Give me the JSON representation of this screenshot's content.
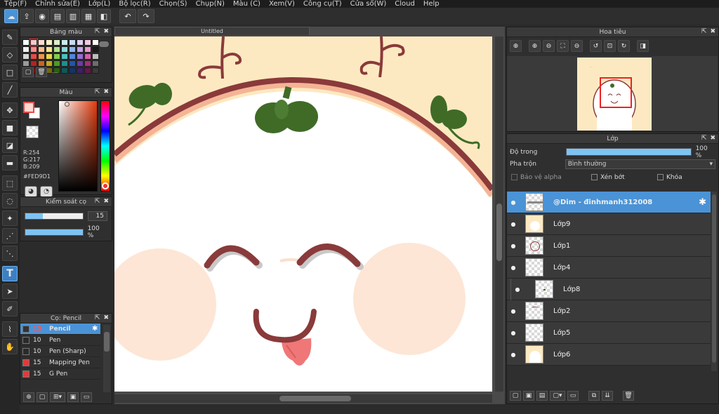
{
  "menu": [
    "Tệp(F)",
    "Chỉnh sửa(E)",
    "Lớp(L)",
    "Bộ lọc(R)",
    "Chọn(S)",
    "Chụp(N)",
    "Màu (C)",
    "Xem(V)",
    "Công cụ(T)",
    "Cửa sổ(W)",
    "Cloud",
    "Help"
  ],
  "canvas": {
    "tab_title": "Untitled"
  },
  "palette_panel": {
    "title": "Bảng màu",
    "footer_text": "---",
    "swatches": [
      "#ffffff",
      "#f9c9c9",
      "#fbe0c8",
      "#f8f1c6",
      "#d9f0c6",
      "#c9ecec",
      "#c8daf5",
      "#e1d2f2",
      "#f2c9e3",
      "#ffffff",
      "#f1f1f1",
      "#f48e8e",
      "#f7bd8c",
      "#f4e58d",
      "#b2e28d",
      "#8dd8d8",
      "#8fb5ec",
      "#c3a6e6",
      "#e79bcb",
      "#1a1a1a",
      "#d6d6d6",
      "#e94848",
      "#ef9547",
      "#ead548",
      "#83cf4e",
      "#4cc0c0",
      "#4f87dd",
      "#9a6ad6",
      "#d75eab",
      "#bdbdbd",
      "#9a9a9a",
      "#b62222",
      "#c8651e",
      "#c3aa1f",
      "#4f9a25",
      "#1f8f8f",
      "#2355a8",
      "#6b3ba8",
      "#a42f7a",
      "#6c6c6c",
      "#5a5a5a",
      "#6e1313",
      "#7a3b10",
      "#766612",
      "#2d5d14",
      "#125757",
      "#143468",
      "#401f68",
      "#63184a",
      "#3a3a3a"
    ]
  },
  "color_panel": {
    "title": "Màu",
    "r": "R:254",
    "g": "G:217",
    "b": "B:209",
    "hex": "#FED9D1",
    "fg_color": "#fed9d1"
  },
  "brush_control": {
    "title": "Kiểm soát cọ",
    "size": "15",
    "opacity": "100 %",
    "size_fraction": 0.3,
    "opacity_fraction": 1.0
  },
  "brush_list": {
    "title": "Cọ: Pencil",
    "items": [
      {
        "size": "15",
        "name": "Pencil",
        "color": "#333333"
      },
      {
        "size": "10",
        "name": "Pen",
        "color": "#2a2a2a"
      },
      {
        "size": "10",
        "name": "Pen (Sharp)",
        "color": "#2a2a2a"
      },
      {
        "size": "15",
        "name": "Mapping Pen",
        "color": "#e33a3a"
      },
      {
        "size": "15",
        "name": "G Pen",
        "color": "#e33a3a"
      }
    ]
  },
  "navigator": {
    "title": "Hoa tiêu"
  },
  "layers": {
    "title": "Lớp",
    "opacity_label": "Độ trong",
    "opacity_value": "100 %",
    "opacity_fraction": 1.0,
    "blend_label": "Pha trộn",
    "blend_value": "Bình thường",
    "alpha_label": "Bảo vệ alpha",
    "clip_label": "Xén bớt",
    "lock_label": "Khóa",
    "items": [
      {
        "name": "@Dim - đinhmanh312008",
        "selected": true
      },
      {
        "name": "Lớp9"
      },
      {
        "name": "Lớp1"
      },
      {
        "name": "Lớp4"
      },
      {
        "name": "Lớp8",
        "indent": true
      },
      {
        "name": "Lớp2"
      },
      {
        "name": "Lớp5"
      },
      {
        "name": "Lớp6"
      }
    ]
  },
  "colors": {
    "accent": "#4a93d6",
    "canvas_bg": "#fde9c1",
    "outline": "#8a3a3a",
    "leaf": "#3f6b27",
    "blush": "#fde6d6",
    "tongue": "#f07777"
  }
}
